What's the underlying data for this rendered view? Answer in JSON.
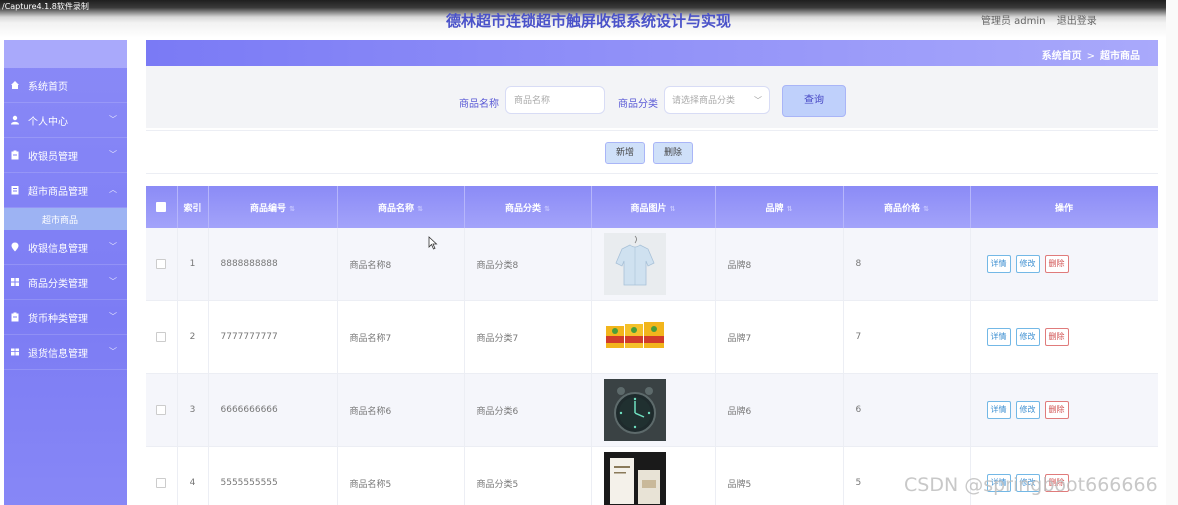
{
  "recorder_label": "/Capture4.1.8软件录制",
  "app_title": "德林超市连锁超市触屏收银系统设计与实现",
  "user": {
    "greeting": "管理员 admin",
    "logout": "退出登录"
  },
  "sidebar": {
    "items": [
      {
        "label": "系统首页",
        "icon": "home-icon",
        "has_children": false
      },
      {
        "label": "个人中心",
        "icon": "user-icon",
        "has_children": true
      },
      {
        "label": "收银员管理",
        "icon": "clipboard-icon",
        "has_children": true
      },
      {
        "label": "超市商品管理",
        "icon": "document-icon",
        "has_children": true,
        "expanded": true
      },
      {
        "label": "收银信息管理",
        "icon": "location-pin-icon",
        "has_children": true
      },
      {
        "label": "商品分类管理",
        "icon": "grid-icon",
        "has_children": true
      },
      {
        "label": "货币种类管理",
        "icon": "clipboard-icon",
        "has_children": true
      },
      {
        "label": "退货信息管理",
        "icon": "table-icon",
        "has_children": true
      }
    ],
    "submenu": {
      "label": "超市商品"
    }
  },
  "breadcrumb": {
    "home": "系统首页",
    "separator": ">",
    "current": "超市商品"
  },
  "search": {
    "name_label": "商品名称",
    "name_placeholder": "商品名称",
    "category_label": "商品分类",
    "category_placeholder": "请选择商品分类",
    "query_button": "查询"
  },
  "actions": {
    "add": "新增",
    "delete": "删除"
  },
  "table": {
    "headers": {
      "index": "索引",
      "code": "商品编号",
      "name": "商品名称",
      "category": "商品分类",
      "image": "商品图片",
      "brand": "品牌",
      "price": "商品价格",
      "ops": "操作"
    },
    "rows": [
      {
        "index": "1",
        "code": "8888888888",
        "name": "商品名称8",
        "category": "商品分类8",
        "image": "shirt-image",
        "brand": "品牌8",
        "price": "8"
      },
      {
        "index": "2",
        "code": "7777777777",
        "name": "商品名称7",
        "category": "商品分类7",
        "image": "juice-boxes-image",
        "brand": "品牌7",
        "price": "7"
      },
      {
        "index": "3",
        "code": "6666666666",
        "name": "商品名称6",
        "category": "商品分类6",
        "image": "alarm-clock-image",
        "brand": "品牌6",
        "price": "6"
      },
      {
        "index": "4",
        "code": "5555555555",
        "name": "商品名称5",
        "category": "商品分类5",
        "image": "product-box-image",
        "brand": "品牌5",
        "price": "5"
      }
    ],
    "op_labels": {
      "detail": "详情",
      "edit": "修改",
      "delete": "删除"
    }
  },
  "watermark": "CSDN @springboot666666",
  "colors": {
    "accent": "#7c7cf4",
    "title": "#4a52c9",
    "header": "#8b8bf6",
    "delete": "#d05050",
    "detail": "#3d8fd1"
  }
}
